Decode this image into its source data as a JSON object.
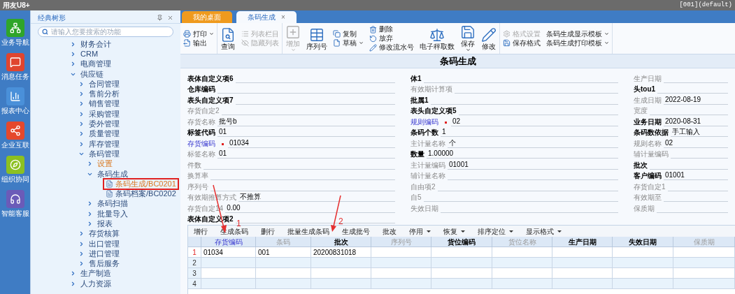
{
  "window": {
    "title": "用友U8+",
    "account": "[001](default)"
  },
  "rail": [
    {
      "label": "业务导航",
      "color": "#2fa52a"
    },
    {
      "label": "消息任务",
      "color": "#e0452f"
    },
    {
      "label": "报表中心",
      "color": "#4a90d9"
    },
    {
      "label": "企业互联",
      "color": "#e5482c"
    },
    {
      "label": "组织协同",
      "color": "#8cc021"
    },
    {
      "label": "智能客服",
      "color": "#6b5bb8"
    }
  ],
  "nav": {
    "title": "经典树形",
    "search": {
      "placeholder": "请输入您要搜索的功能"
    },
    "tree": [
      {
        "label": "财务会计",
        "kind": "folder",
        "expanded": false,
        "selected": false,
        "visited": false
      },
      {
        "label": "CRM",
        "kind": "folder",
        "expanded": false,
        "selected": false,
        "visited": false
      },
      {
        "label": "电商管理",
        "kind": "folder",
        "expanded": false,
        "selected": false,
        "visited": false
      },
      {
        "label": "供应链",
        "kind": "folder",
        "expanded": true,
        "selected": false,
        "visited": false,
        "children": [
          {
            "label": "合同管理",
            "kind": "folder",
            "expanded": false,
            "selected": false,
            "visited": false
          },
          {
            "label": "售前分析",
            "kind": "folder",
            "expanded": false,
            "selected": false,
            "visited": false
          },
          {
            "label": "销售管理",
            "kind": "folder",
            "expanded": false,
            "selected": false,
            "visited": false
          },
          {
            "label": "采购管理",
            "kind": "folder",
            "expanded": false,
            "selected": false,
            "visited": false
          },
          {
            "label": "委外管理",
            "kind": "folder",
            "expanded": false,
            "selected": false,
            "visited": false
          },
          {
            "label": "质量管理",
            "kind": "folder",
            "expanded": false,
            "selected": false,
            "visited": false
          },
          {
            "label": "库存管理",
            "kind": "folder",
            "expanded": false,
            "selected": false,
            "visited": false
          },
          {
            "label": "条码管理",
            "kind": "folder",
            "expanded": true,
            "selected": false,
            "visited": false,
            "children": [
              {
                "label": "设置",
                "kind": "folder",
                "expanded": false,
                "selected": false,
                "visited": true
              },
              {
                "label": "条码生成",
                "kind": "folder",
                "expanded": true,
                "selected": false,
                "visited": false,
                "children": [
                  {
                    "label": "条码生成/BC0201",
                    "kind": "document",
                    "selected": true,
                    "visited": true
                  },
                  {
                    "label": "条码档案/BC0202",
                    "kind": "document",
                    "selected": false,
                    "visited": false
                  }
                ]
              },
              {
                "label": "条码扫描",
                "kind": "folder",
                "expanded": false,
                "selected": false,
                "visited": false
              },
              {
                "label": "批量导入",
                "kind": "folder",
                "expanded": false,
                "selected": false,
                "visited": false
              },
              {
                "label": "报表",
                "kind": "folder",
                "expanded": false,
                "selected": false,
                "visited": false
              }
            ]
          },
          {
            "label": "存货核算",
            "kind": "folder",
            "expanded": false,
            "selected": false,
            "visited": false
          },
          {
            "label": "出口管理",
            "kind": "folder",
            "expanded": false,
            "selected": false,
            "visited": false
          },
          {
            "label": "进口管理",
            "kind": "folder",
            "expanded": false,
            "selected": false,
            "visited": false
          },
          {
            "label": "售后服务",
            "kind": "folder",
            "expanded": false,
            "selected": false,
            "visited": false
          }
        ]
      },
      {
        "label": "生产制造",
        "kind": "folder",
        "expanded": false,
        "selected": false,
        "visited": false
      },
      {
        "label": "人力资源",
        "kind": "folder",
        "expanded": false,
        "selected": false,
        "visited": false
      }
    ]
  },
  "tabs": [
    {
      "label": "我的桌面",
      "selected": false
    },
    {
      "label": "条码生成",
      "selected": true,
      "close": "×"
    }
  ],
  "toolbar": {
    "groups": [
      {
        "columns": [
          {
            "kind": "stack",
            "items": [
              {
                "label": "打印",
                "disabled": false,
                "dropdown": true
              },
              {
                "label": "输出",
                "disabled": false,
                "dropdown": false
              }
            ]
          }
        ]
      },
      {
        "columns": [
          {
            "kind": "large",
            "items": [
              {
                "label": "查询",
                "disabled": false,
                "dropdown": false
              }
            ]
          },
          {
            "kind": "stack",
            "items": [
              {
                "label": "列表栏目",
                "disabled": true,
                "dropdown": false
              },
              {
                "label": "隐藏列表",
                "disabled": true,
                "dropdown": false
              }
            ]
          }
        ]
      },
      {
        "columns": [
          {
            "kind": "large",
            "items": [
              {
                "label": "增加",
                "disabled": true,
                "dropdown": true
              }
            ]
          },
          {
            "kind": "large",
            "items": [
              {
                "label": "序列号",
                "disabled": false,
                "dropdown": false
              }
            ]
          },
          {
            "kind": "stack",
            "items": [
              {
                "label": "复制",
                "disabled": false,
                "dropdown": false
              },
              {
                "label": "草稿",
                "disabled": false,
                "dropdown": true
              }
            ]
          },
          {
            "kind": "stack",
            "items": [
              {
                "label": "删除",
                "disabled": false,
                "dropdown": false
              },
              {
                "label": "放弃",
                "disabled": false,
                "dropdown": false
              },
              {
                "label": "修改流水号",
                "disabled": false,
                "dropdown": false
              }
            ]
          },
          {
            "kind": "large",
            "items": [
              {
                "label": "电子秤取数",
                "disabled": false,
                "dropdown": false
              }
            ]
          },
          {
            "kind": "large",
            "items": [
              {
                "label": "保存",
                "disabled": false,
                "dropdown": true
              }
            ]
          },
          {
            "kind": "large",
            "items": [
              {
                "label": "修改",
                "disabled": false,
                "dropdown": false
              }
            ]
          }
        ]
      },
      {
        "columns": [
          {
            "kind": "stack",
            "items": [
              {
                "label": "格式设置",
                "disabled": true,
                "dropdown": false
              },
              {
                "label": "保存格式",
                "disabled": false,
                "dropdown": false
              }
            ]
          },
          {
            "kind": "stack",
            "items": [
              {
                "label": "条码生成显示模板",
                "disabled": false,
                "dropdown": true
              },
              {
                "label": "条码生成打印模板",
                "disabled": false,
                "dropdown": true
              }
            ]
          }
        ]
      }
    ]
  },
  "form": {
    "title": "条码生成",
    "columns": [
      [
        {
          "label": "表体自定义项6",
          "kind": "bold"
        },
        {
          "label": "仓库编码",
          "kind": "bold"
        },
        {
          "label": "表头自定义项7",
          "kind": "bold"
        },
        {
          "label": "存货自定2",
          "kind": "gray"
        },
        {
          "label": "存货名称",
          "kind": "gray",
          "value": "批号b"
        },
        {
          "label": "标签代码",
          "kind": "bold",
          "value": "01"
        },
        {
          "label": "存货编码",
          "kind": "link",
          "required": true,
          "value": "01034"
        },
        {
          "label": "标签名称",
          "kind": "gray",
          "value": "01"
        },
        {
          "label": "件数",
          "kind": "gray"
        },
        {
          "label": "换算率",
          "kind": "gray"
        },
        {
          "label": "序列号",
          "kind": "gray"
        },
        {
          "label": "有效期推算方式",
          "kind": "gray",
          "value": "不推算"
        },
        {
          "label": "存货自定14",
          "kind": "gray",
          "value": "0.00"
        },
        {
          "label": "表体自定义项2",
          "kind": "bold"
        }
      ],
      [
        {
          "label": "体1",
          "kind": "bold"
        },
        {
          "label": "有效期计算项",
          "kind": "gray"
        },
        {
          "label": "批属1",
          "kind": "bold"
        },
        {
          "label": "表头自定义项5",
          "kind": "bold"
        },
        {
          "label": "规则编码",
          "kind": "link",
          "required": true,
          "value": "02"
        },
        {
          "label": "条码个数",
          "kind": "bold",
          "value": "1"
        },
        {
          "label": "主计量名称",
          "kind": "gray",
          "value": "个"
        },
        {
          "label": "数量",
          "kind": "bold",
          "value": "1.00000"
        },
        {
          "label": "主计量编码",
          "kind": "gray",
          "value": "01001"
        },
        {
          "label": "辅计量名称",
          "kind": "gray"
        },
        {
          "label": "自由项2",
          "kind": "gray"
        },
        {
          "label": "自5",
          "kind": "gray"
        },
        {
          "label": "失效日期",
          "kind": "gray"
        }
      ],
      [
        {
          "label": "生产日期",
          "kind": "gray"
        },
        {
          "label": "头tou1",
          "kind": "bold"
        },
        {
          "label": "生成日期",
          "kind": "gray",
          "value": "2022-08-19"
        },
        {
          "label": "宽度",
          "kind": "gray"
        },
        {
          "label": "业务日期",
          "kind": "bold",
          "value": "2020-08-31"
        },
        {
          "label": "条码数依据",
          "kind": "bold",
          "value": "手工输入"
        },
        {
          "label": "规则名称",
          "kind": "gray",
          "value": "02"
        },
        {
          "label": "辅计量编码",
          "kind": "gray"
        },
        {
          "label": "批次",
          "kind": "bold"
        },
        {
          "label": "客户编码",
          "kind": "bold",
          "value": "01001"
        },
        {
          "label": "存货自定1",
          "kind": "gray"
        },
        {
          "label": "有效期至",
          "kind": "gray"
        },
        {
          "label": "保质期",
          "kind": "gray"
        }
      ]
    ]
  },
  "grid": {
    "toolbar": [
      {
        "label": "增行",
        "dropdown": false
      },
      {
        "label": "生成条码",
        "dropdown": false
      },
      {
        "label": "删行",
        "dropdown": false
      },
      {
        "label": "批量生成条码",
        "dropdown": false
      },
      {
        "label": "生成批号",
        "dropdown": false
      },
      {
        "label": "批改",
        "dropdown": false
      },
      {
        "label": "停用",
        "dropdown": true
      },
      {
        "label": "恢复",
        "dropdown": true
      },
      {
        "label": "排序定位",
        "dropdown": true
      },
      {
        "label": "显示格式",
        "dropdown": true
      }
    ],
    "columns": [
      {
        "label": "存货编码",
        "kind": "link"
      },
      {
        "label": "条码",
        "kind": "gray"
      },
      {
        "label": "批次",
        "kind": "bold"
      },
      {
        "label": "序列号",
        "kind": "gray"
      },
      {
        "label": "货位编码",
        "kind": "bold"
      },
      {
        "label": "货位名称",
        "kind": "gray"
      },
      {
        "label": "生产日期",
        "kind": "bold"
      },
      {
        "label": "失效日期",
        "kind": "bold"
      },
      {
        "label": "保质期",
        "kind": "gray"
      }
    ],
    "rows": [
      {
        "number": "1",
        "current": true,
        "cells": [
          "01034",
          "001",
          "20200831018"
        ]
      },
      {
        "number": "2",
        "current": false
      },
      {
        "number": "3",
        "current": false
      },
      {
        "number": "4",
        "current": false
      }
    ]
  },
  "annotations": [
    {
      "label": "1"
    },
    {
      "label": "2"
    }
  ]
}
